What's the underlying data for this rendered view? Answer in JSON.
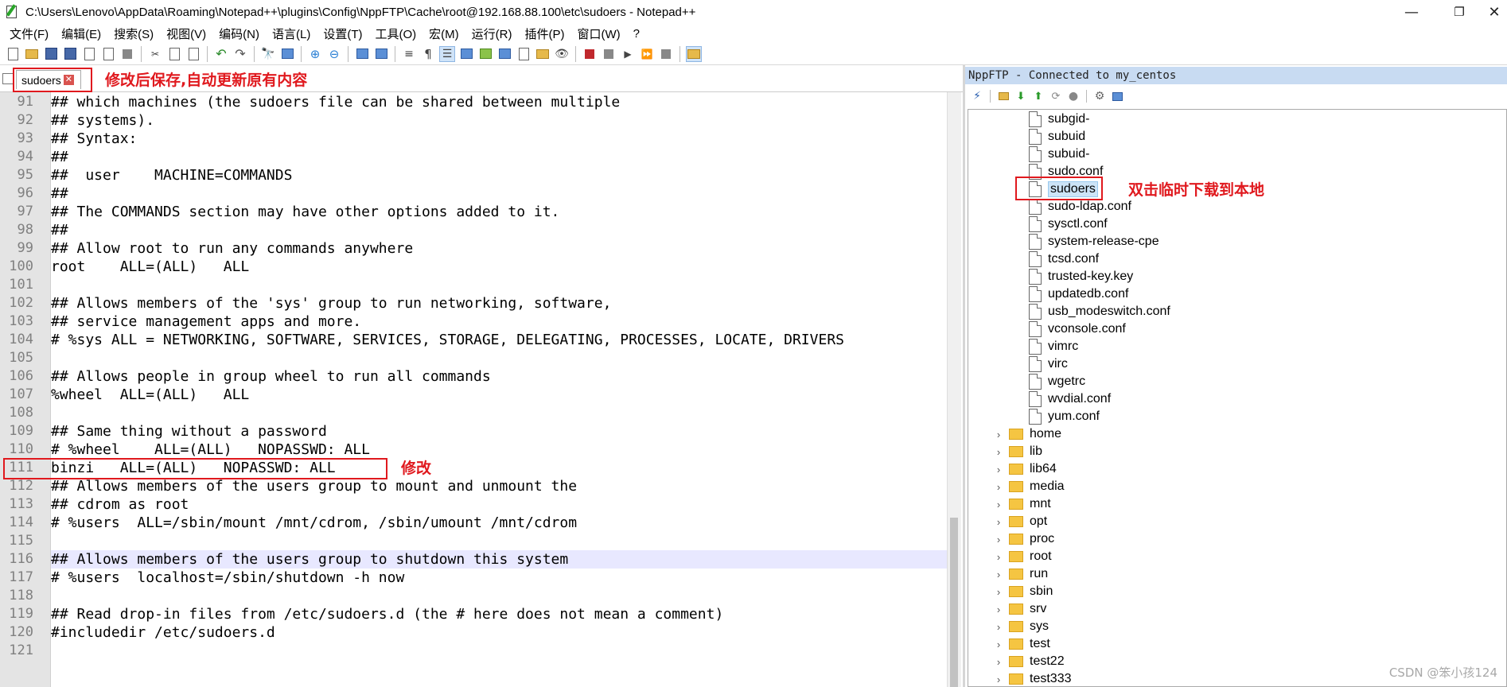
{
  "window": {
    "title": "C:\\Users\\Lenovo\\AppData\\Roaming\\Notepad++\\plugins\\Config\\NppFTP\\Cache\\root@192.168.88.100\\etc\\sudoers - Notepad++",
    "minimize": "—",
    "maximize": "❐",
    "close": "✕"
  },
  "menu": [
    "文件(F)",
    "编辑(E)",
    "搜索(S)",
    "视图(V)",
    "编码(N)",
    "语言(L)",
    "设置(T)",
    "工具(O)",
    "宏(M)",
    "运行(R)",
    "插件(P)",
    "窗口(W)",
    "?"
  ],
  "tab": {
    "label": "sudoers",
    "close": "✕"
  },
  "annotations": {
    "tab_note": "修改后保存,自动更新原有内容",
    "edit_note": "修改",
    "file_note": "双击临时下载到本地"
  },
  "editor": {
    "lines": [
      {
        "n": "91",
        "text": "## which machines (the sudoers file can be shared between multiple"
      },
      {
        "n": "92",
        "text": "## systems)."
      },
      {
        "n": "93",
        "text": "## Syntax:"
      },
      {
        "n": "94",
        "text": "##"
      },
      {
        "n": "95",
        "text": "##  user    MACHINE=COMMANDS"
      },
      {
        "n": "96",
        "text": "##"
      },
      {
        "n": "97",
        "text": "## The COMMANDS section may have other options added to it."
      },
      {
        "n": "98",
        "text": "##"
      },
      {
        "n": "99",
        "text": "## Allow root to run any commands anywhere"
      },
      {
        "n": "100",
        "text": "root    ALL=(ALL)   ALL"
      },
      {
        "n": "101",
        "text": ""
      },
      {
        "n": "102",
        "text": "## Allows members of the 'sys' group to run networking, software,"
      },
      {
        "n": "103",
        "text": "## service management apps and more."
      },
      {
        "n": "104",
        "text": "# %sys ALL = NETWORKING, SOFTWARE, SERVICES, STORAGE, DELEGATING, PROCESSES, LOCATE, DRIVERS"
      },
      {
        "n": "105",
        "text": ""
      },
      {
        "n": "106",
        "text": "## Allows people in group wheel to run all commands"
      },
      {
        "n": "107",
        "text": "%wheel  ALL=(ALL)   ALL"
      },
      {
        "n": "108",
        "text": ""
      },
      {
        "n": "109",
        "text": "## Same thing without a password"
      },
      {
        "n": "110",
        "text": "# %wheel    ALL=(ALL)   NOPASSWD: ALL"
      },
      {
        "n": "111",
        "text": "binzi   ALL=(ALL)   NOPASSWD: ALL"
      },
      {
        "n": "112",
        "text": "## Allows members of the users group to mount and unmount the"
      },
      {
        "n": "113",
        "text": "## cdrom as root"
      },
      {
        "n": "114",
        "text": "# %users  ALL=/sbin/mount /mnt/cdrom, /sbin/umount /mnt/cdrom"
      },
      {
        "n": "115",
        "text": ""
      },
      {
        "n": "116",
        "text": "## Allows members of the users group to shutdown this system"
      },
      {
        "n": "117",
        "text": "# %users  localhost=/sbin/shutdown -h now"
      },
      {
        "n": "118",
        "text": ""
      },
      {
        "n": "119",
        "text": "## Read drop-in files from /etc/sudoers.d (the # here does not mean a comment)"
      },
      {
        "n": "120",
        "text": "#includedir /etc/sudoers.d"
      },
      {
        "n": "121",
        "text": ""
      }
    ],
    "current_line": "116"
  },
  "nppftp": {
    "header": "NppFTP - Connected to my_centos",
    "files": [
      "subgid-",
      "subuid",
      "subuid-",
      "sudo.conf",
      "sudoers",
      "sudo-ldap.conf",
      "sysctl.conf",
      "system-release-cpe",
      "tcsd.conf",
      "trusted-key.key",
      "updatedb.conf",
      "usb_modeswitch.conf",
      "vconsole.conf",
      "vimrc",
      "virc",
      "wgetrc",
      "wvdial.conf",
      "yum.conf"
    ],
    "selected_file": "sudoers",
    "folders": [
      "home",
      "lib",
      "lib64",
      "media",
      "mnt",
      "opt",
      "proc",
      "root",
      "run",
      "sbin",
      "srv",
      "sys",
      "test",
      "test22",
      "test333"
    ]
  },
  "watermark": "CSDN @笨小孩124",
  "colors": {
    "annotation": "#e0191e",
    "selection": "#cce4f7",
    "current_line": "#e8e8ff"
  }
}
